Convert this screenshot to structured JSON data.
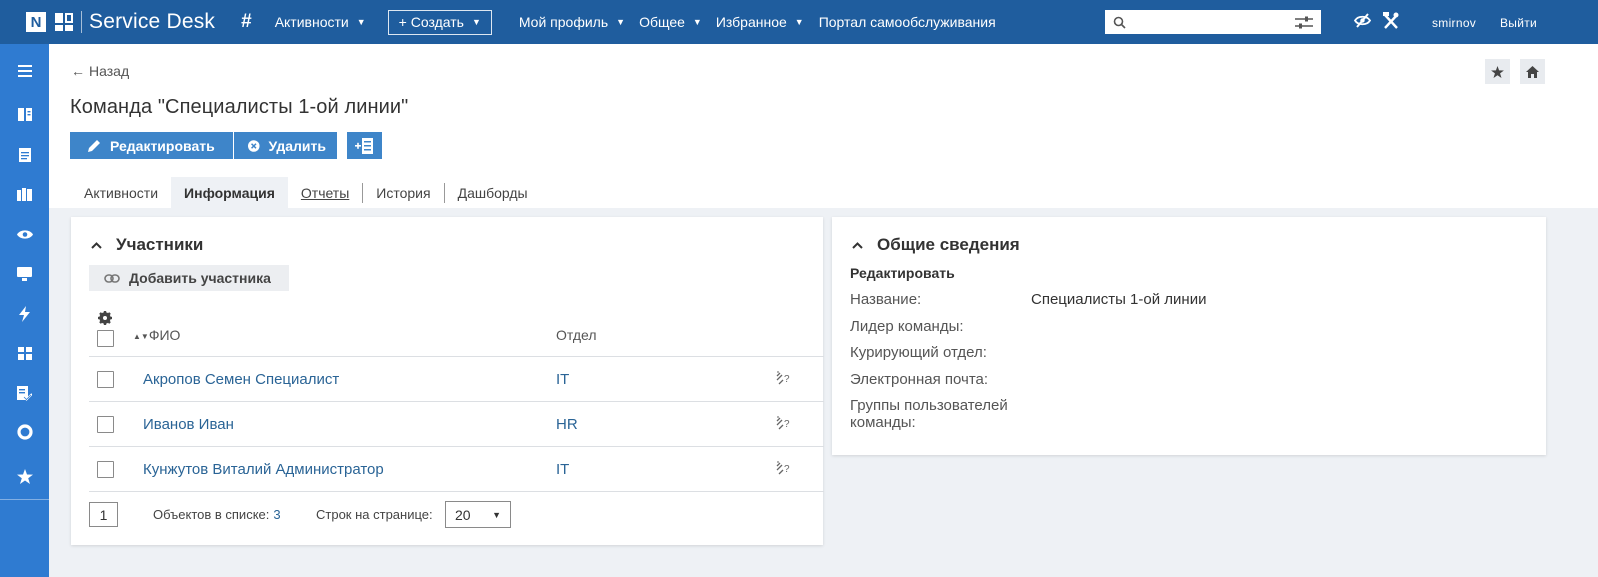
{
  "topbar": {
    "logo_letter": "N",
    "app_name": "Service Desk",
    "menu": [
      {
        "label": "Активности",
        "caret": true
      },
      {
        "label": "+ Создать",
        "caret": true
      },
      {
        "label": "Мой профиль",
        "caret": true
      },
      {
        "label": "Общее",
        "caret": true
      },
      {
        "label": "Избранное",
        "caret": true
      },
      {
        "label": "Портал самообслуживания",
        "caret": false
      }
    ],
    "search_placeholder": "",
    "username": "smirnov",
    "logout": "Выйти",
    "bg_color": "#1f5d9e"
  },
  "sidebar": {
    "color": "#2f7bd1",
    "icons": [
      "menu-icon",
      "book-icon",
      "document-icon",
      "library-icon",
      "eye-icon",
      "monitor-icon",
      "lightning-icon",
      "dashboard-icon",
      "edit-check-icon",
      "lifebuoy-icon",
      "star-icon"
    ]
  },
  "page": {
    "back_label": "Назад",
    "title": "Команда \"Специалисты 1-ой линии\"",
    "actions": {
      "edit": "Редактировать",
      "delete": "Удалить"
    },
    "tabs": [
      {
        "label": "Активности",
        "state": "normal"
      },
      {
        "label": "Информация",
        "state": "active"
      },
      {
        "label": "Отчеты",
        "state": "link"
      },
      {
        "label": "История",
        "state": "normal"
      },
      {
        "label": "Дашборды",
        "state": "normal"
      }
    ]
  },
  "members": {
    "title": "Участники",
    "add_button": "Добавить участника",
    "columns": {
      "name": "ФИО",
      "department": "Отдел"
    },
    "rows": [
      {
        "name": "Акропов Семен Специалист",
        "department": "IT"
      },
      {
        "name": "Иванов Иван",
        "department": "HR"
      },
      {
        "name": "Кунжутов Виталий Администратор",
        "department": "IT"
      }
    ],
    "pager": {
      "page": "1",
      "count_label": "Объектов в списке:",
      "count": "3",
      "rows_label": "Строк на странице:",
      "rows_per_page": "20"
    }
  },
  "general": {
    "title": "Общие сведения",
    "edit_link": "Редактировать",
    "fields": [
      {
        "label": "Название:",
        "value": "Специалисты 1-ой линии"
      },
      {
        "label": "Лидер команды:",
        "value": ""
      },
      {
        "label": "Курирующий отдел:",
        "value": ""
      },
      {
        "label": "Электронная почта:",
        "value": ""
      },
      {
        "label": "Группы пользователей команды:",
        "value": ""
      }
    ]
  }
}
